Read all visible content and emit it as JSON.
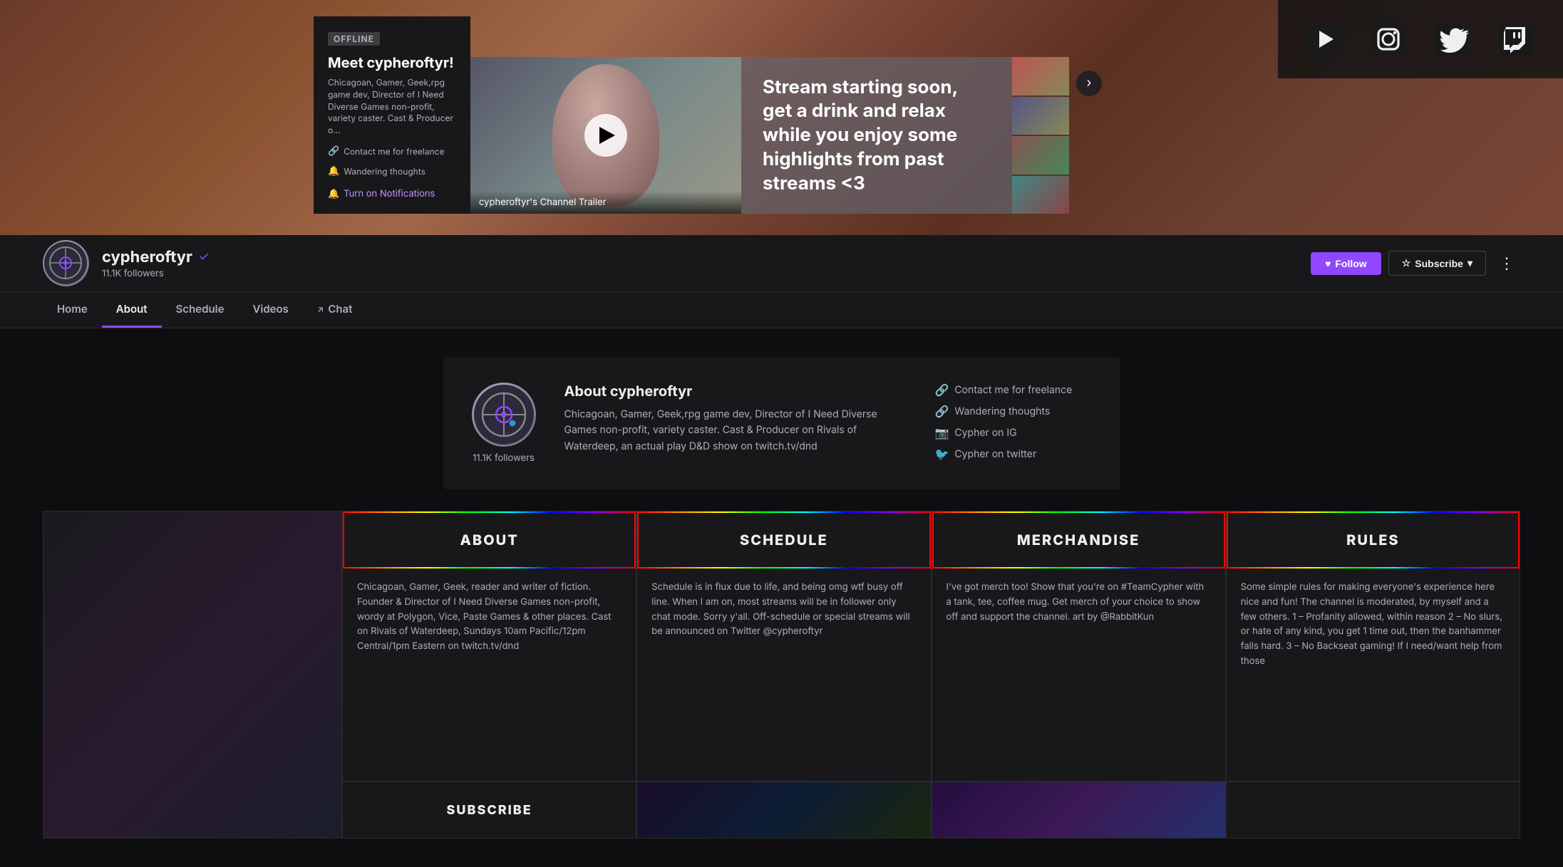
{
  "banner": {
    "offline_label": "OFFLINE",
    "panel_title": "Meet cypheroftyr!",
    "panel_desc": "Chicagoan, Gamer, Geek,rpg game dev, Director of I Need Diverse Games non-profit, variety caster. Cast & Producer o...",
    "panel_link1": "Contact me for freelance",
    "panel_link2": "Wandering thoughts",
    "panel_notify": "Turn on Notifications",
    "video_label": "cypheroftyr's Channel Trailer",
    "highlight_text": "Stream starting soon, get a drink and relax while you enjoy some highlights from past streams <3"
  },
  "social": {
    "youtube_icon": "▶",
    "instagram_icon": "📷",
    "twitter_icon": "🐦",
    "twitch_icon": "📺"
  },
  "profile": {
    "username": "cypheroftyr",
    "verified": true,
    "followers": "11.1K followers",
    "follow_label": "Follow",
    "subscribe_label": "Subscribe",
    "heart_icon": "♥"
  },
  "nav": {
    "tabs": [
      {
        "label": "Home",
        "active": false
      },
      {
        "label": "About",
        "active": true
      },
      {
        "label": "Schedule",
        "active": false
      },
      {
        "label": "Videos",
        "active": false
      },
      {
        "label": "Chat",
        "active": false,
        "external": true
      }
    ]
  },
  "about": {
    "title": "About cypheroftyr",
    "bio": "Chicagoan, Gamer, Geek,rpg game dev, Director of I Need Diverse Games non-profit, variety caster. Cast & Producer on Rivals of Waterdeep, an actual play D&D show on twitch.tv/dnd",
    "followers": "11.1K followers",
    "links": [
      {
        "icon": "🔗",
        "label": "Contact me for freelance"
      },
      {
        "icon": "🔗",
        "label": "Wandering thoughts"
      },
      {
        "icon": "📷",
        "label": "Cypher on IG"
      },
      {
        "icon": "🐦",
        "label": "Cypher on twitter"
      }
    ]
  },
  "panels": [
    {
      "id": "about",
      "header": "ABOUT",
      "body": "Chicagoan, Gamer, Geek, reader and writer of fiction. Founder & Director of I Need Diverse Games non-profit, wordy at Polygon, Vice, Paste Games & other places.\n\nCast on Rivals of Waterdeep, Sundays 10am Pacific/12pm Central/1pm Eastern on twitch.tv/dnd"
    },
    {
      "id": "schedule",
      "header": "SCHEDULE",
      "body": "Schedule is in flux due to life, and being omg wtf busy off line. When I am on, most streams will be in follower only chat mode. Sorry y'all.\n\nOff-schedule or special streams will be announced on Twitter @cypheroftyr"
    },
    {
      "id": "merchandise",
      "header": "MERCHANDISE",
      "body": "I've got merch too! Show that you're on #TeamCypher with a tank, tee, coffee mug. Get merch of your choice to show off and support the channel.\n\nart by @RabbitKun"
    },
    {
      "id": "rules",
      "header": "RULES",
      "body": "Some simple rules for making everyone's experience here nice and fun! The channel is moderated, by myself and a few others.\n\n1 – Profanity allowed, within reason\n\n2 – No slurs, or hate of any kind, you get 1 time out, then the banhammer falls hard.\n\n3 – No Backseat gaming! If I need/want help from those"
    }
  ],
  "bottom_panels": [
    {
      "id": "subscribe",
      "header": "SUBSCRIBE"
    }
  ]
}
